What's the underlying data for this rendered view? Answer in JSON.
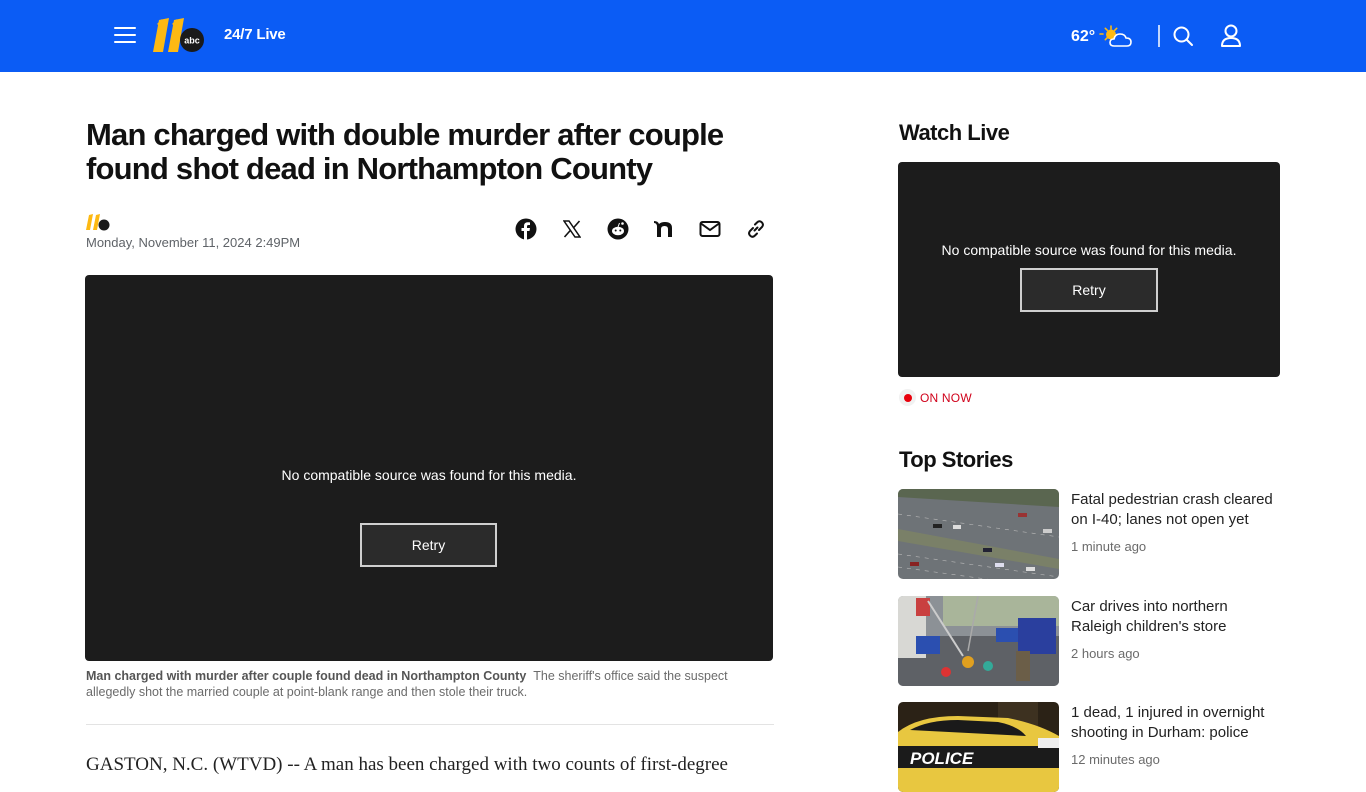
{
  "header": {
    "brand_logo_text": "abc",
    "brand_number": "11",
    "live_label": "24/7 Live",
    "temperature": "62°",
    "weather_icon": "partly-sunny-icon",
    "search_icon": "search-icon",
    "account_icon": "user-icon",
    "menu_icon": "hamburger-icon",
    "brand_color": "#0b5cf5",
    "logo_color": "#fdb913"
  },
  "article": {
    "headline": "Man charged with double murder after couple found shot dead in Northampton County",
    "date": "Monday, November 11, 2024 2:49PM",
    "share_buttons": [
      {
        "name": "facebook",
        "icon": "facebook-icon"
      },
      {
        "name": "x",
        "icon": "x-icon"
      },
      {
        "name": "reddit",
        "icon": "reddit-icon"
      },
      {
        "name": "nextdoor",
        "icon": "nextdoor-icon"
      },
      {
        "name": "email",
        "icon": "email-icon"
      },
      {
        "name": "copy-link",
        "icon": "link-icon"
      }
    ],
    "video": {
      "error_message": "No compatible source was found for this media.",
      "retry_label": "Retry"
    },
    "caption_title": "Man charged with murder after couple found dead in Northampton County",
    "caption_text": "The sheriff's office said the suspect allegedly shot the married couple at point-blank range and then stole their truck.",
    "body_first_line": "GASTON, N.C. (WTVD) -- A man has been charged with two counts of first-degree"
  },
  "sidebar": {
    "watch_live_heading": "Watch Live",
    "live_video": {
      "error_message": "No compatible source was found for this media.",
      "retry_label": "Retry"
    },
    "on_now_label": "ON NOW",
    "top_stories_heading": "Top Stories",
    "stories": [
      {
        "title": "Fatal pedestrian crash cleared on I-40; lanes not open yet",
        "time": "1 minute ago",
        "thumb": "highway-aerial"
      },
      {
        "title": "Car drives into northern Raleigh children's store",
        "time": "2 hours ago",
        "thumb": "store-crash"
      },
      {
        "title": "1 dead, 1 injured in overnight shooting in Durham: police",
        "time": "12 minutes ago",
        "thumb": "police-car"
      }
    ]
  }
}
